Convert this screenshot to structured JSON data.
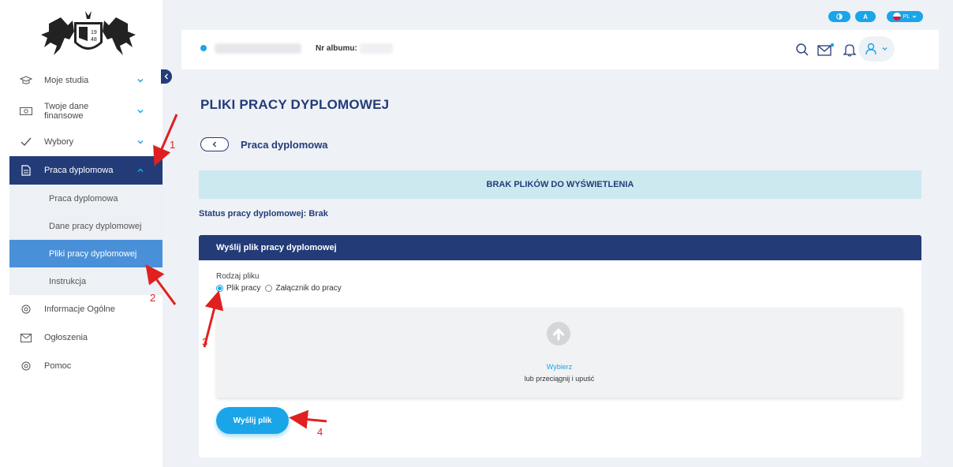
{
  "topbar": {
    "contrast_label": "",
    "font_label": "A",
    "lang_label": "PL"
  },
  "header": {
    "album_label": "Nr albumu:"
  },
  "sidebar": {
    "items": [
      {
        "label": "Moje studia",
        "icon": "graduation-cap-icon"
      },
      {
        "label": "Twoje dane finansowe",
        "icon": "money-icon"
      },
      {
        "label": "Wybory",
        "icon": "check-icon"
      },
      {
        "label": "Praca dyplomowa",
        "icon": "document-icon"
      },
      {
        "label": "Informacje Ogólne",
        "icon": "info-icon"
      },
      {
        "label": "Ogłoszenia",
        "icon": "envelope-icon"
      },
      {
        "label": "Pomoc",
        "icon": "help-icon"
      }
    ],
    "subitems": [
      {
        "label": "Praca dyplomowa"
      },
      {
        "label": "Dane pracy dyplomowej"
      },
      {
        "label": "Pliki pracy dyplomowej"
      },
      {
        "label": "Instrukcja"
      }
    ]
  },
  "main": {
    "page_title": "PLIKI PRACY DYPLOMOWEJ",
    "section_title": "Praca dyplomowa",
    "empty_message": "BRAK PLIKÓW DO WYŚWIETLENIA",
    "status_text": "Status pracy dyplomowej: Brak",
    "card": {
      "title": "Wyślij plik pracy dyplomowej",
      "field_label": "Rodzaj pliku",
      "radio_options": [
        "Plik pracy",
        "Załącznik do pracy"
      ],
      "selected_option": "Plik pracy",
      "choose_link": "Wybierz",
      "drop_text": "lub przeciągnij i upuść",
      "send_button": "Wyślij plik"
    }
  },
  "annotations": [
    "1",
    "2",
    "3",
    "4"
  ],
  "colors": {
    "navy": "#233c78",
    "accent": "#1aa5e8",
    "active_sub": "#4a90d9",
    "annotation": "#e02020"
  }
}
